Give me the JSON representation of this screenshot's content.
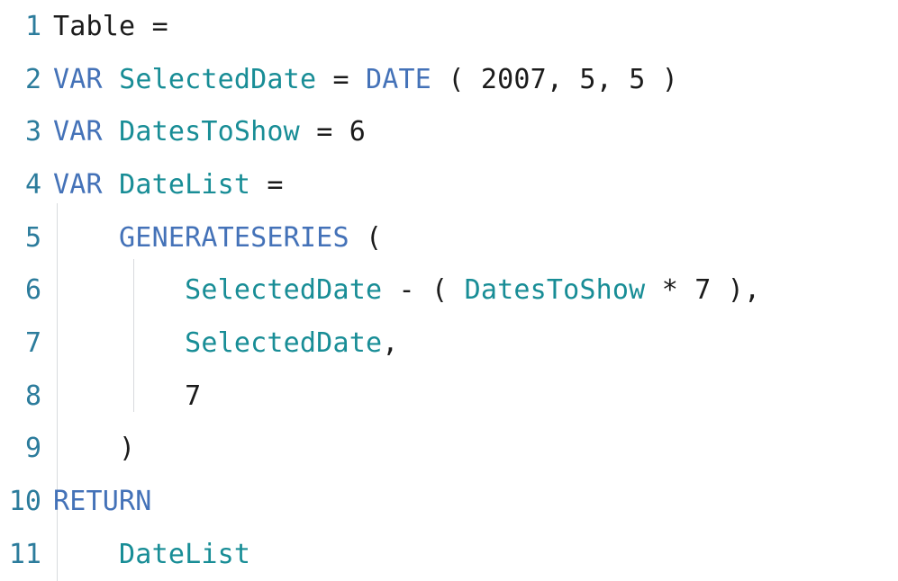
{
  "editor": {
    "language": "DAX",
    "background_color": "#ffffff",
    "gutter_color": "#2c7c9c",
    "indent_guide_color": "#d8dadd",
    "colors": {
      "keyword": "#4472b8",
      "function": "#4472b8",
      "variable": "#188d96",
      "number": "#1b1b1b",
      "punctuation": "#1b1b1b",
      "operator": "#1b1b1b",
      "plain": "#1b1b1b"
    },
    "line_numbers": [
      "1",
      "2",
      "3",
      "4",
      "5",
      "6",
      "7",
      "8",
      "9",
      "10",
      "11"
    ],
    "lines": [
      {
        "number": "1",
        "text": "Table =",
        "tokens": [
          {
            "t": "Table",
            "k": "plain"
          },
          {
            "t": " ",
            "k": "plain"
          },
          {
            "t": "=",
            "k": "op"
          }
        ]
      },
      {
        "number": "2",
        "text": "VAR SelectedDate = DATE ( 2007, 5, 5 )",
        "tokens": [
          {
            "t": "VAR",
            "k": "kw"
          },
          {
            "t": " ",
            "k": "plain"
          },
          {
            "t": "SelectedDate",
            "k": "var"
          },
          {
            "t": " ",
            "k": "plain"
          },
          {
            "t": "=",
            "k": "op"
          },
          {
            "t": " ",
            "k": "plain"
          },
          {
            "t": "DATE",
            "k": "func"
          },
          {
            "t": " ",
            "k": "plain"
          },
          {
            "t": "(",
            "k": "punct"
          },
          {
            "t": " ",
            "k": "plain"
          },
          {
            "t": "2007",
            "k": "num"
          },
          {
            "t": ",",
            "k": "punct"
          },
          {
            "t": " ",
            "k": "plain"
          },
          {
            "t": "5",
            "k": "num"
          },
          {
            "t": ",",
            "k": "punct"
          },
          {
            "t": " ",
            "k": "plain"
          },
          {
            "t": "5",
            "k": "num"
          },
          {
            "t": " ",
            "k": "plain"
          },
          {
            "t": ")",
            "k": "punct"
          }
        ]
      },
      {
        "number": "3",
        "text": "VAR DatesToShow = 6",
        "tokens": [
          {
            "t": "VAR",
            "k": "kw"
          },
          {
            "t": " ",
            "k": "plain"
          },
          {
            "t": "DatesToShow",
            "k": "var"
          },
          {
            "t": " ",
            "k": "plain"
          },
          {
            "t": "=",
            "k": "op"
          },
          {
            "t": " ",
            "k": "plain"
          },
          {
            "t": "6",
            "k": "num"
          }
        ]
      },
      {
        "number": "4",
        "text": "VAR DateList =",
        "tokens": [
          {
            "t": "VAR",
            "k": "kw"
          },
          {
            "t": " ",
            "k": "plain"
          },
          {
            "t": "DateList",
            "k": "var"
          },
          {
            "t": " ",
            "k": "plain"
          },
          {
            "t": "=",
            "k": "op"
          }
        ]
      },
      {
        "number": "5",
        "text": "    GENERATESERIES (",
        "tokens": [
          {
            "t": "    ",
            "k": "plain"
          },
          {
            "t": "GENERATESERIES",
            "k": "func"
          },
          {
            "t": " ",
            "k": "plain"
          },
          {
            "t": "(",
            "k": "punct"
          }
        ]
      },
      {
        "number": "6",
        "text": "        SelectedDate - ( DatesToShow * 7 ),",
        "tokens": [
          {
            "t": "        ",
            "k": "plain"
          },
          {
            "t": "SelectedDate",
            "k": "var"
          },
          {
            "t": " ",
            "k": "plain"
          },
          {
            "t": "-",
            "k": "op"
          },
          {
            "t": " ",
            "k": "plain"
          },
          {
            "t": "(",
            "k": "punct"
          },
          {
            "t": " ",
            "k": "plain"
          },
          {
            "t": "DatesToShow",
            "k": "var"
          },
          {
            "t": " ",
            "k": "plain"
          },
          {
            "t": "*",
            "k": "op"
          },
          {
            "t": " ",
            "k": "plain"
          },
          {
            "t": "7",
            "k": "num"
          },
          {
            "t": " ",
            "k": "plain"
          },
          {
            "t": ")",
            "k": "punct"
          },
          {
            "t": ",",
            "k": "punct"
          }
        ]
      },
      {
        "number": "7",
        "text": "        SelectedDate,",
        "tokens": [
          {
            "t": "        ",
            "k": "plain"
          },
          {
            "t": "SelectedDate",
            "k": "var"
          },
          {
            "t": ",",
            "k": "punct"
          }
        ]
      },
      {
        "number": "8",
        "text": "        7",
        "tokens": [
          {
            "t": "        ",
            "k": "plain"
          },
          {
            "t": "7",
            "k": "num"
          }
        ]
      },
      {
        "number": "9",
        "text": "    )",
        "tokens": [
          {
            "t": "    ",
            "k": "plain"
          },
          {
            "t": ")",
            "k": "punct"
          }
        ]
      },
      {
        "number": "10",
        "text": "RETURN",
        "tokens": [
          {
            "t": "RETURN",
            "k": "kw"
          }
        ]
      },
      {
        "number": "11",
        "text": "    DateList",
        "tokens": [
          {
            "t": "    ",
            "k": "plain"
          },
          {
            "t": "DateList",
            "k": "var"
          }
        ]
      }
    ]
  }
}
